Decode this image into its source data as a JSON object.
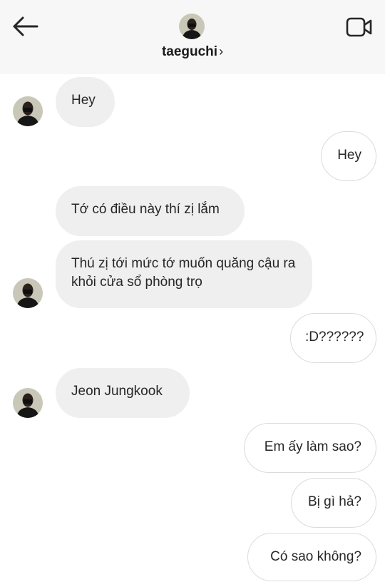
{
  "header": {
    "username": "taeguchi",
    "back_icon": "arrow-left-icon",
    "video_icon": "video-camera-icon",
    "chevron": "›"
  },
  "messages": [
    {
      "from": "them",
      "text": "Hey"
    },
    {
      "from": "me",
      "text": "Hey"
    },
    {
      "from": "them",
      "text": "Tớ có điều này thí zị lắm"
    },
    {
      "from": "them",
      "text": "Thú zị tới mức tớ muốn quăng cậu ra khỏi cửa sổ phòng trọ"
    },
    {
      "from": "me",
      "text": ":D??????"
    },
    {
      "from": "them",
      "text": "Jeon Jungkook"
    },
    {
      "from": "me",
      "text": "Em ấy làm sao?"
    },
    {
      "from": "me",
      "text": "Bị gì hả?"
    },
    {
      "from": "me",
      "text": "Có sao không?"
    }
  ],
  "colors": {
    "header_bg": "#f7f7f7",
    "incoming_bubble": "#efefef",
    "outgoing_border": "#dbdbdb"
  }
}
